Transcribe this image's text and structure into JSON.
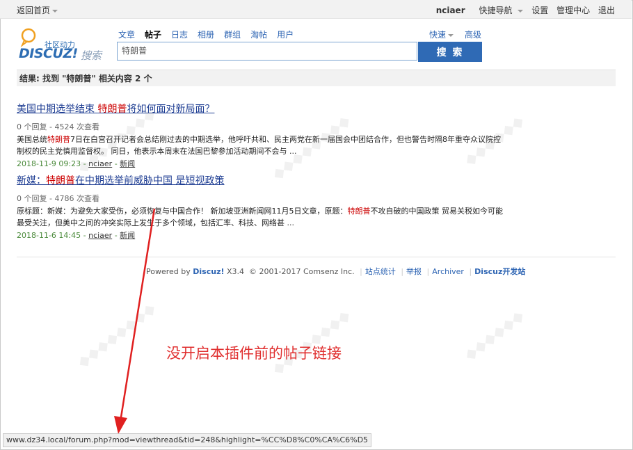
{
  "topbar": {
    "home": "返回首页",
    "user": "nciaer",
    "links": [
      "快捷导航",
      "设置",
      "管理中心",
      "退出"
    ]
  },
  "logo": {
    "community": "社区动力",
    "brand": "DISCUZ!",
    "sub": "搜索"
  },
  "search": {
    "tabs": [
      "文章",
      "帖子",
      "日志",
      "相册",
      "群组",
      "淘帖",
      "用户"
    ],
    "active_tab": "帖子",
    "quick": "快速",
    "advanced": "高级",
    "query": "特朗普",
    "button": "搜 索"
  },
  "results": {
    "summary_prefix": "结果: 找到 \"",
    "summary_query": "特朗普",
    "summary_suffix": "\" 相关内容 2 个",
    "items": [
      {
        "title_pre": "美国中期选举结束 ",
        "title_hl": "特朗普",
        "title_post": "将如何面对新局面？",
        "meta": "0 个回复 - 4524 次查看",
        "snippet_pre": "美国总统",
        "snippet_hl": "特朗普",
        "snippet_post": "7日在白宫召开记者会总结刚过去的中期选举，他呼吁共和、民主两党在新一届国会中团结合作，但也警告时隔8年重夺众议院控制权的民主党慎用监督权。 同日，他表示本周末在法国巴黎参加活动期间不会与 ...",
        "date": "2018-11-9 09:23",
        "author": "nciaer",
        "category": "新闻"
      },
      {
        "title_pre": "新媒：",
        "title_hl": "特朗普",
        "title_post": "在中期选举前威胁中国 是短视政策",
        "meta": "0 个回复 - 4786 次查看",
        "snippet_pre": "原标题：新媒：为避免大家受伤，必须恢复与中国合作！ 新加坡亚洲新闻网11月5日文章，原题：",
        "snippet_hl": "特朗普",
        "snippet_post": "不攻自破的中国政策 贸易关税如今可能最受关注，但美中之间的冲突实际上发生于多个领域，包括汇率、科技、网络甚 ...",
        "date": "2018-11-6 14:45",
        "author": "nciaer",
        "category": "新闻"
      }
    ]
  },
  "footer": {
    "powered": "Powered by",
    "brand": "Discuz!",
    "version": "X3.4",
    "copyright": "© 2001-2017 Comsenz Inc.",
    "links": [
      "站点统计",
      "举报",
      "Archiver",
      "Discuz开发站"
    ]
  },
  "annotation": "没开启本插件前的帖子链接",
  "statusbar": "www.dz34.local/forum.php?mod=viewthread&tid=248&highlight=%CC%D8%C0%CA%C6%D5",
  "colors": {
    "accent": "#2f6ab5",
    "highlight": "#cc0000",
    "annotation": "#e03030"
  }
}
